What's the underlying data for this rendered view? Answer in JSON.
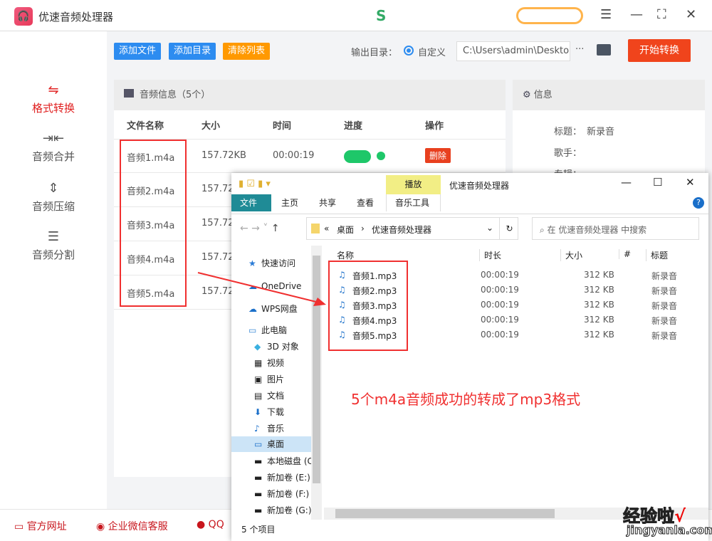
{
  "app": {
    "title": "优速音频处理器",
    "logo_icon": "headphones-icon"
  },
  "window_controls": {
    "menu": "☰",
    "minimize": "—",
    "maximize": "⛶",
    "close": "✕"
  },
  "sidebar": {
    "items": [
      {
        "label": "格式转换",
        "icon": "convert-icon",
        "active": true
      },
      {
        "label": "音频合并",
        "icon": "merge-icon"
      },
      {
        "label": "音频压缩",
        "icon": "compress-icon"
      },
      {
        "label": "音频分割",
        "icon": "split-icon"
      }
    ]
  },
  "toolbar": {
    "add_file": "添加文件",
    "add_dir": "添加目录",
    "clear_list": "清除列表",
    "output_label": "输出目录：",
    "radio_label": "自定义",
    "output_path": "C:\\Users\\admin\\Deskto",
    "more": "···",
    "start": "开始转换"
  },
  "audio_panel": {
    "title": "音频信息（5个）",
    "columns": [
      "文件名称",
      "大小",
      "时间",
      "进度",
      "操作"
    ],
    "rows": [
      {
        "name": "音频1.m4a",
        "size": "157.72KB",
        "time": "00:00:19",
        "action": "删除"
      },
      {
        "name": "音频2.m4a",
        "size": "157.72"
      },
      {
        "name": "音频3.m4a",
        "size": "157.72"
      },
      {
        "name": "音频4.m4a",
        "size": "157.72"
      },
      {
        "name": "音频5.m4a",
        "size": "157.72"
      }
    ]
  },
  "info_panel": {
    "title": "信息",
    "title_label": "标题：",
    "title_value": "新录音",
    "artist_label": "歌手：",
    "album_label": "专辑："
  },
  "bottom": {
    "website": "官方网址",
    "wechat": "企业微信客服",
    "qq": "QQ"
  },
  "explorer": {
    "context_tab": "播放",
    "title": "优速音频处理器",
    "tabs": [
      "文件",
      "主页",
      "共享",
      "查看",
      "音乐工具"
    ],
    "breadcrumb": [
      "«",
      "桌面",
      "›",
      "优速音频处理器"
    ],
    "search_placeholder": "在 优速音频处理器 中搜索",
    "nav": [
      "快速访问",
      "OneDrive",
      "WPS网盘",
      "此电脑",
      "3D 对象",
      "视频",
      "图片",
      "文档",
      "下载",
      "音乐",
      "桌面",
      "本地磁盘 (C",
      "新加卷 (E:)",
      "新加卷 (F:)",
      "新加卷 (G:)"
    ],
    "columns": [
      "名称",
      "时长",
      "大小",
      "#",
      "标题"
    ],
    "files": [
      {
        "name": "音频1.mp3",
        "duration": "00:00:19",
        "size": "312 KB",
        "title": "新录音"
      },
      {
        "name": "音频2.mp3",
        "duration": "00:00:19",
        "size": "312 KB",
        "title": "新录音"
      },
      {
        "name": "音频3.mp3",
        "duration": "00:00:19",
        "size": "312 KB",
        "title": "新录音"
      },
      {
        "name": "音频4.mp3",
        "duration": "00:00:19",
        "size": "312 KB",
        "title": "新录音"
      },
      {
        "name": "音频5.mp3",
        "duration": "00:00:19",
        "size": "312 KB",
        "title": "新录音"
      }
    ],
    "status": "5 个项目"
  },
  "annotation": {
    "text": "5个m4a音频成功的转成了mp3格式",
    "color": "#f03030"
  },
  "watermark": {
    "line1": "经验啦",
    "line2": "jingyanla.com"
  },
  "colors": {
    "accent_red": "#e02020",
    "blue_btn": "#2d8cf0",
    "orange_btn": "#ff9900",
    "start_btn": "#f0441c",
    "ribbon_file": "#1f8b96"
  }
}
